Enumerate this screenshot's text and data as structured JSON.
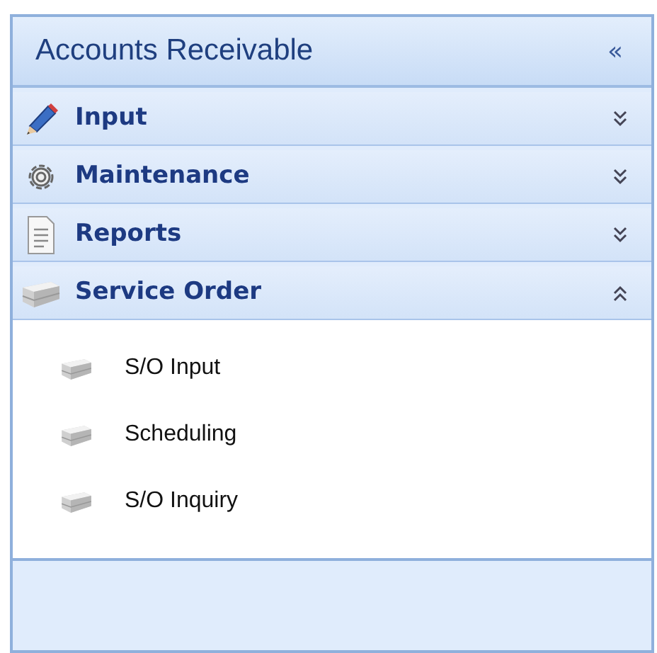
{
  "panel": {
    "title": "Accounts Receivable",
    "collapse_glyph": "«"
  },
  "groups": [
    {
      "label": "Input",
      "kind": "pencil",
      "expanded": false
    },
    {
      "label": "Maintenance",
      "kind": "gear",
      "expanded": false
    },
    {
      "label": "Reports",
      "kind": "document",
      "expanded": false
    },
    {
      "label": "Service Order",
      "kind": "brick",
      "expanded": true,
      "items": [
        {
          "label": "S/O Input"
        },
        {
          "label": "Scheduling"
        },
        {
          "label": "S/O Inquiry"
        }
      ]
    }
  ]
}
